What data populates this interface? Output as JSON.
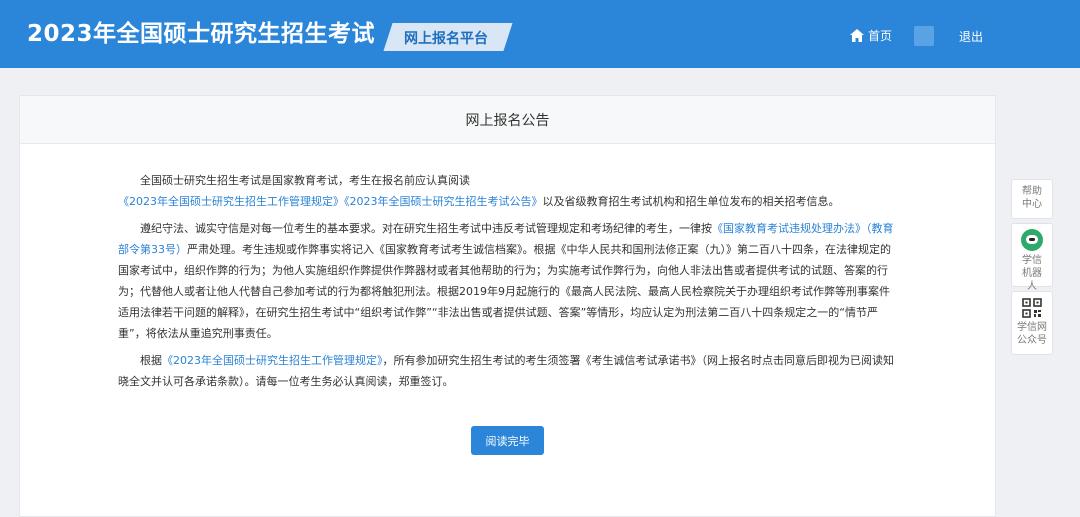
{
  "header": {
    "title": "2023年全国硕士研究生招生考试",
    "platform": "网上报名平台",
    "home_label": "首页",
    "logout_label": "退出"
  },
  "notice": {
    "heading": "网上报名公告",
    "p1_a": "全国硕士研究生招生考试是国家教育考试，考生在报名前应认真阅读",
    "p1_link": "《2023年全国硕士研究生招生工作管理规定》《2023年全国硕士研究生招生考试公告》",
    "p1_b": "以及省级教育招生考试机构和招生单位发布的相关招考信息。",
    "p2_a": "遵纪守法、诚实守信是对每一位考生的基本要求。对在研究生招生考试中违反考试管理规定和考场纪律的考生，一律按",
    "p2_link": "《国家教育考试违规处理办法》（教育部令第33号）",
    "p2_b": "严肃处理。考生违规或作弊事实将记入《国家教育考试考生诚信档案》。根据《中华人民共和国刑法修正案（九）》第二百八十四条，在法律规定的国家考试中，组织作弊的行为；为他人实施组织作弊提供作弊器材或者其他帮助的行为；为实施考试作弊行为，向他人非法出售或者提供考试的试题、答案的行为；代替他人或者让他人代替自己参加考试的行为都将触犯刑法。根据2019年9月起施行的《最高人民法院、最高人民检察院关于办理组织考试作弊等刑事案件适用法律若干问题的解释》，在研究生招生考试中“组织考试作弊”“非法出售或者提供试题、答案”等情形，均应认定为刑法第二百八十四条规定之一的“情节严重”，将依法从重追究刑事责任。",
    "p3_a": "根据",
    "p3_link": "《2023年全国硕士研究生招生工作管理规定》",
    "p3_b": "，所有参加研究生招生考试的考生须签署《考生诚信考试承诺书》（网上报名时点击同意后即视为已阅读知晓全文并认可各承诺条款）。请每一位考生务必认真阅读，郑重签订。",
    "button_label": "阅读完毕"
  },
  "side_tools": {
    "help": "帮助中心",
    "robot": "学信机器人",
    "wechat": "学信网公众号"
  },
  "colors": {
    "header_bg": "#2b86d9",
    "link": "#2a83d6",
    "button_bg": "#2b86d9"
  },
  "icons": {
    "home": "home-icon",
    "robot": "robot-icon",
    "qr": "qr-code-icon"
  }
}
